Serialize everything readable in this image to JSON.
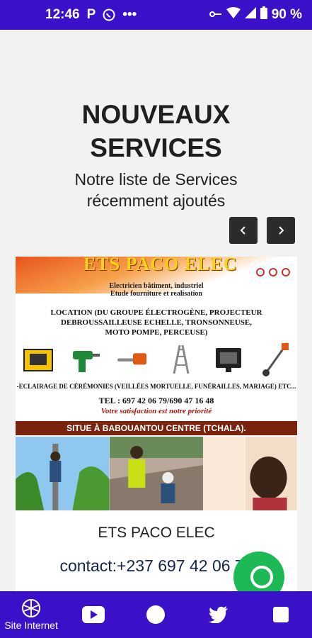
{
  "status_bar": {
    "time": "12:46",
    "left_icons": [
      "parking-icon",
      "whatsapp-icon",
      "more-dots-icon"
    ],
    "right_icons": [
      "key-icon",
      "wifi-icon",
      "signal-icon",
      "battery-icon"
    ],
    "battery": "90 %"
  },
  "header": {
    "title_line1": "NOUVEAUX",
    "title_line2": "SERVICES",
    "subtitle_line1": "Notre liste de Services",
    "subtitle_line2": "récemment ajoutés"
  },
  "carousel": {
    "prev_icon": "chevron-left-icon",
    "next_icon": "chevron-right-icon"
  },
  "card": {
    "flyer": {
      "brand": "ETS PACO ELEC",
      "sub_line1": "Electricien bâtiment, industriel",
      "sub_line2": "Etude fourniture et realisation",
      "location_line1": "LOCATION (DU GROUPE ÉLECTROGÈNE, PROJECTEUR",
      "location_line2": "DEBROUSSAILLEUSE ECHELLE, TRONSONNEUSE,",
      "location_line3": "MOTO POMPE, PERCEUSE)",
      "lighting": "-ECLAIRAGE DE CÉRÉMONIES (VEILLÉES MORTUELLE, FUNÉRAILLES, MARIAGE) ETC...",
      "tel": "TEL : 697 42 06 79/690 47 16 48",
      "motto": "Votre satisfaction est notre priorité",
      "location_bar": "SITUE À BABOUANTOU CENTRE (TCHALA)."
    },
    "title": "ETS PACO ELEC",
    "contact": "contact:+237 697 42 06 79"
  },
  "bottom_nav": {
    "tabs": [
      {
        "icon": "globe-icon",
        "label": "Site Internet"
      },
      {
        "icon": "youtube-icon",
        "label": ""
      },
      {
        "icon": "circle-icon",
        "label": ""
      },
      {
        "icon": "twitter-icon",
        "label": ""
      },
      {
        "icon": "square-icon",
        "label": ""
      }
    ]
  },
  "colors": {
    "primary": "#3a10c8",
    "fab": "#1db954",
    "title_text": "#1f1f1f"
  }
}
